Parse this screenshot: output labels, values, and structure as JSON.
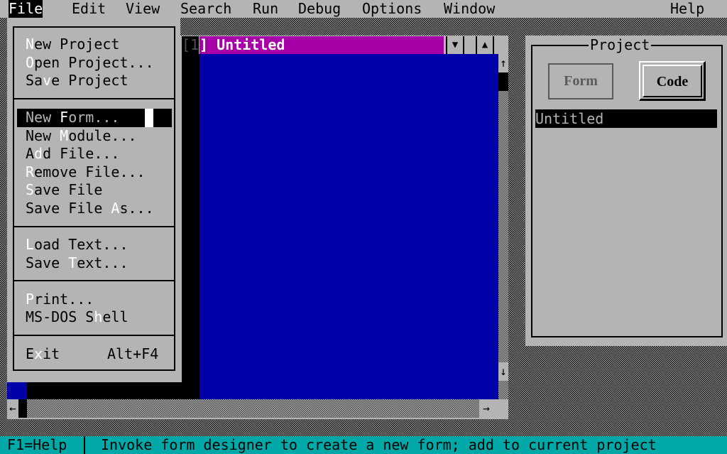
{
  "menubar": {
    "items": [
      {
        "label": "File",
        "active": true
      },
      {
        "label": "Edit"
      },
      {
        "label": "View"
      },
      {
        "label": "Search"
      },
      {
        "label": "Run"
      },
      {
        "label": "Debug"
      },
      {
        "label": "Options"
      },
      {
        "label": "Window"
      },
      {
        "label": "Help"
      }
    ]
  },
  "file_menu": {
    "groups": [
      [
        {
          "pre": "",
          "hotkey": "N",
          "post": "ew Project"
        },
        {
          "pre": "",
          "hotkey": "O",
          "post": "pen Project..."
        },
        {
          "pre": "Sa",
          "hotkey": "v",
          "post": "e Project"
        }
      ],
      [
        {
          "pre": "New ",
          "hotkey": "F",
          "post": "orm...",
          "selected": true
        },
        {
          "pre": "New ",
          "hotkey": "M",
          "post": "odule..."
        },
        {
          "pre": "A",
          "hotkey": "d",
          "post": "d File..."
        },
        {
          "pre": "",
          "hotkey": "R",
          "post": "emove File..."
        },
        {
          "pre": "",
          "hotkey": "S",
          "post": "ave File"
        },
        {
          "pre": "Save File ",
          "hotkey": "A",
          "post": "s..."
        }
      ],
      [
        {
          "pre": "",
          "hotkey": "L",
          "post": "oad Text..."
        },
        {
          "pre": "Save ",
          "hotkey": "T",
          "post": "ext..."
        }
      ],
      [
        {
          "pre": "",
          "hotkey": "P",
          "post": "rint..."
        },
        {
          "pre": "MS-DOS S",
          "hotkey": "h",
          "post": "ell"
        }
      ],
      [
        {
          "pre": "E",
          "hotkey": "x",
          "post": "it",
          "shortcut": "Alt+F4"
        }
      ]
    ]
  },
  "code_window": {
    "number": "[1",
    "title": "] Untitled",
    "icons": {
      "minimize": "▼",
      "maximize": "▲",
      "scroll_up": "↑",
      "scroll_down": "↓",
      "scroll_left": "←",
      "scroll_right": "→"
    }
  },
  "project_window": {
    "title": "Project",
    "form_button": "Form",
    "code_button": "Code",
    "items": [
      "Untitled"
    ]
  },
  "statusbar": {
    "help": "F1=Help",
    "message": "Invoke form designer to create a new form; add to current project"
  },
  "colors": {
    "menu_bg": "#b4b4b4",
    "editor_bg": "#0000a8",
    "title_active": "#a800a8",
    "status_bg": "#00a8a8"
  }
}
